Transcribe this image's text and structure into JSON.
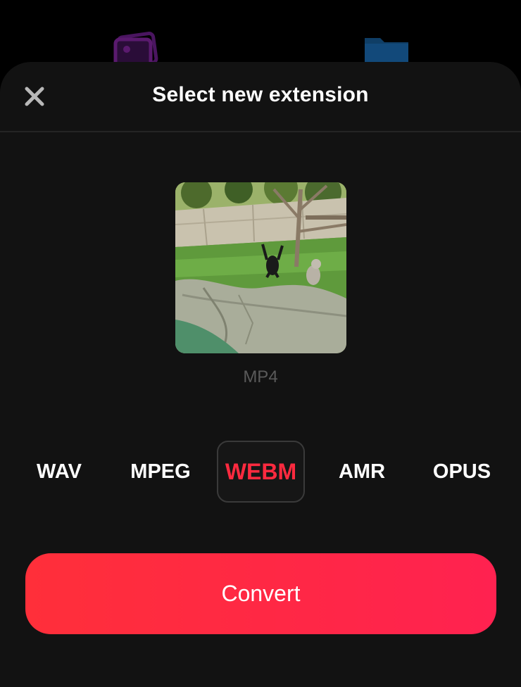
{
  "background_icons": [
    {
      "name": "gallery-icon",
      "color": "#5a1a6e"
    },
    {
      "name": "folder-icon",
      "color": "#0f3e66"
    }
  ],
  "sheet": {
    "title": "Select new extension",
    "close_icon": "close-icon",
    "thumbnail": {
      "description_icon": "video-thumbnail",
      "source_extension": "MP4"
    },
    "extensions": [
      {
        "label": "WAV",
        "selected": false
      },
      {
        "label": "MPEG",
        "selected": false
      },
      {
        "label": "WEBM",
        "selected": true
      },
      {
        "label": "AMR",
        "selected": false
      },
      {
        "label": "OPUS",
        "selected": false
      }
    ],
    "convert_label": "Convert"
  },
  "colors": {
    "accent": "#ff2a3f",
    "sheet_background": "#121212",
    "muted_text": "#5a5a5a"
  }
}
